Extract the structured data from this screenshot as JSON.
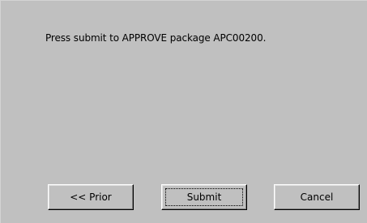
{
  "dialog": {
    "message": "Press submit to APPROVE package APC00200."
  },
  "buttons": {
    "prior_label": "<< Prior",
    "submit_label": "Submit",
    "cancel_label": "Cancel"
  },
  "colors": {
    "dialog_background": "#c0c0c0",
    "outer_background": "#ffffff"
  }
}
